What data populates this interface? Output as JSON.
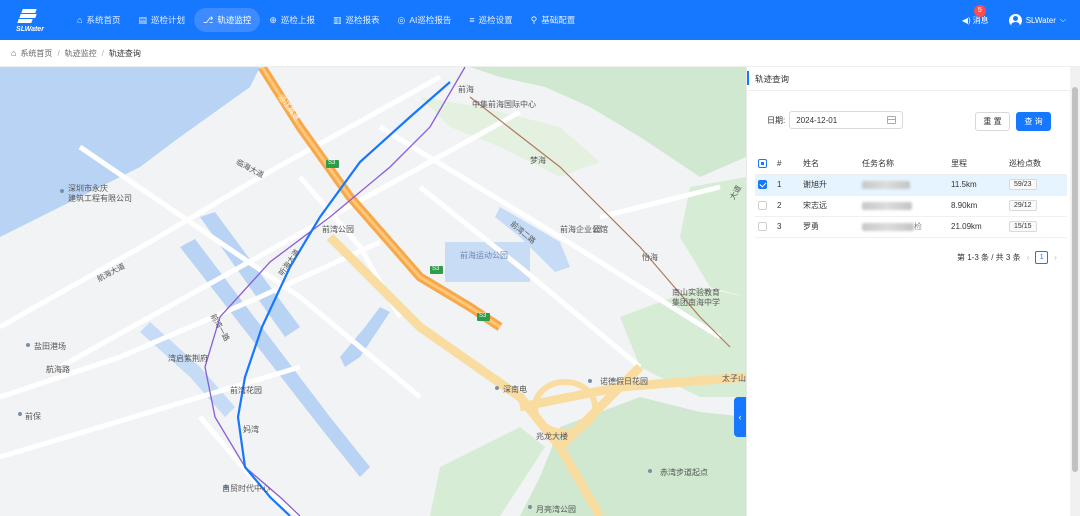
{
  "brand": {
    "logo_text": "SLWater"
  },
  "nav": [
    {
      "icon": "⌂",
      "label": "系统首页"
    },
    {
      "icon": "▤",
      "label": "巡检计划"
    },
    {
      "icon": "⎇",
      "label": "轨迹监控"
    },
    {
      "icon": "⊕",
      "label": "巡检上报"
    },
    {
      "icon": "▥",
      "label": "巡检报表"
    },
    {
      "icon": "◎",
      "label": "AI巡检报告"
    },
    {
      "icon": "≡",
      "label": "巡检设置"
    },
    {
      "icon": "⚲",
      "label": "基础配置"
    }
  ],
  "header": {
    "message_label": "消息",
    "message_count": "5",
    "username": "SLWater"
  },
  "breadcrumb": [
    "系统首页",
    "轨迹监控",
    "轨迹查询"
  ],
  "panel": {
    "title": "轨迹查询",
    "date_label": "日期:",
    "date_value": "2024-12-01",
    "reset_label": "重 置",
    "query_label": "查 询",
    "columns": [
      "#",
      "姓名",
      "任务名称",
      "里程",
      "巡检点数"
    ],
    "rows": [
      {
        "index": "1",
        "name": "谢旭升",
        "distance": "11.5km",
        "points": "59/23",
        "selected": true
      },
      {
        "index": "2",
        "name": "宋志远",
        "distance": "8.90km",
        "points": "29/12",
        "selected": false
      },
      {
        "index": "3",
        "name": "罗勇",
        "task_tail": "检",
        "distance": "21.09km",
        "points": "15/15",
        "selected": false
      }
    ],
    "pagination": {
      "summary": "第 1-3 条 / 共 3 条",
      "page": "1"
    }
  },
  "map": {
    "labels": [
      "深圳市永庆",
      "建筑工程有限公司",
      "前海",
      "中集前海国际中心",
      "梦海",
      "前湾公园",
      "前海运动公园",
      "前海企业公馆",
      "怡海",
      "南山实验教育",
      "集团南海中学",
      "湾启紫荆府",
      "盐田港场",
      "航海路",
      "前湾花园",
      "深南电",
      "诺德假日花园",
      "太子山",
      "兆龙大楼",
      "妈湾",
      "前保",
      "自贸时代中心",
      "月亮湾公园",
      "赤湾步道起点",
      "临海大道",
      "前湾一路",
      "前湾二路",
      "航海大道",
      "听海大道",
      "沿江高速",
      "大道",
      "园"
    ],
    "road_badges": [
      "S3",
      "S3",
      "S3"
    ],
    "colors": {
      "water": "#b9d3f5",
      "green": "#cfe8cf",
      "highway": "#f7a84a",
      "major_road": "#f9dca0",
      "track": "#1677ff",
      "metro": "#8a5cd6"
    }
  },
  "colors": {
    "primary": "#1677ff"
  }
}
